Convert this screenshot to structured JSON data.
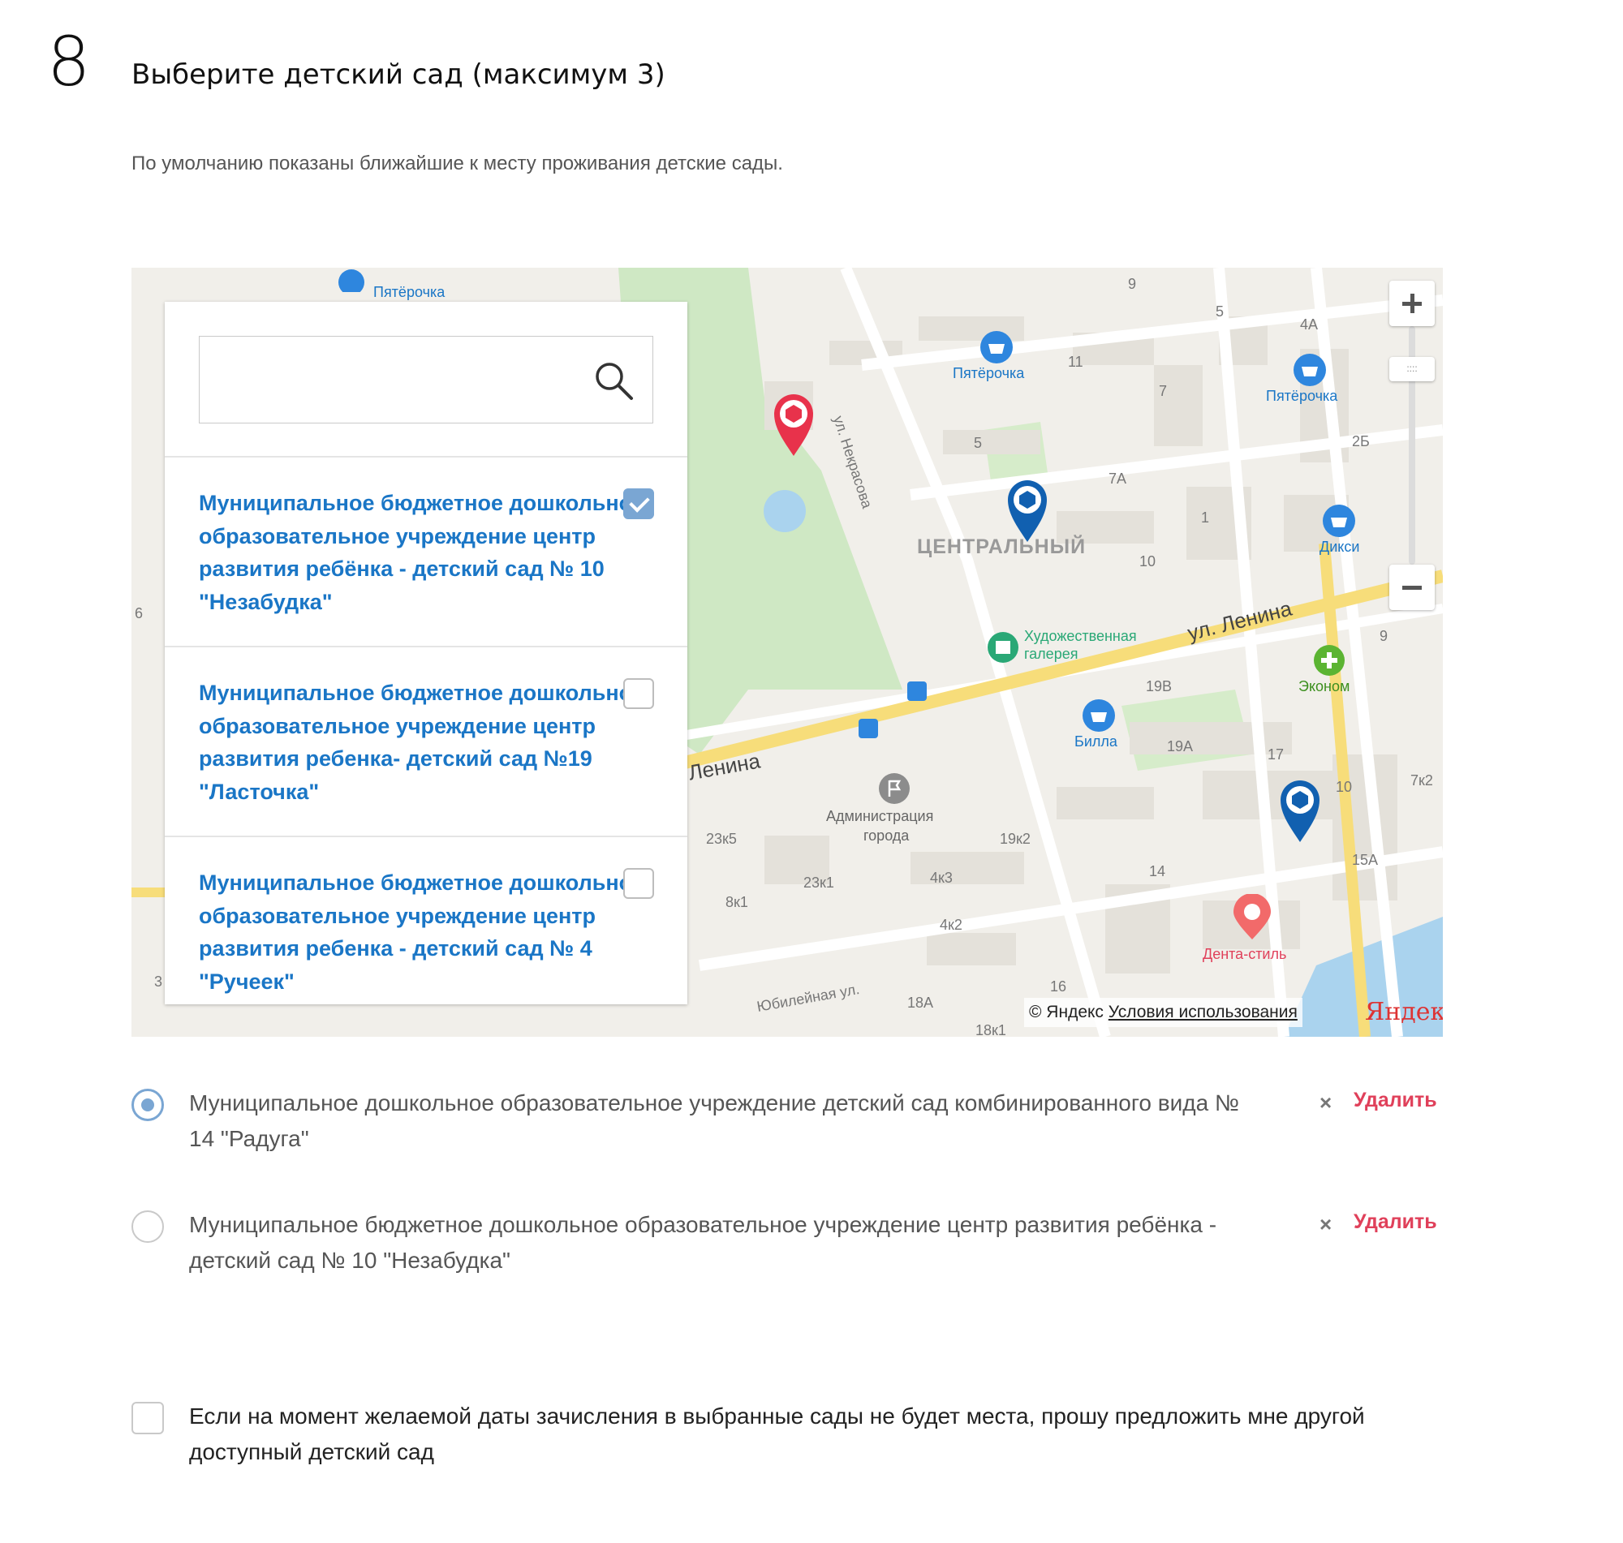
{
  "step": {
    "number": "8",
    "title": "Выберите детский сад (максимум 3)",
    "hint": "По умолчанию показаны ближайшие к месту проживания детские сады."
  },
  "search": {
    "placeholder": "",
    "icon": "search-icon"
  },
  "list": [
    {
      "name": "Муниципальное бюджетное дошкольное образовательное учреждение центр развития ребёнка - детский сад № 10 \"Незабудка\"",
      "checked": true
    },
    {
      "name": "Муниципальное бюджетное дошкольное образовательное учреждение центр развития ребенка- детский сад №19 \"Ласточка\"",
      "checked": false
    },
    {
      "name": "Муниципальное бюджетное дошкольное образовательное учреждение центр развития ребенка - детский сад № 4 \"Ручеек\"",
      "checked": false
    }
  ],
  "map": {
    "streets": {
      "nekrasova": "ул. Некрасова",
      "lenina": "ул. Ленина",
      "lenina_left": "Ленина",
      "yubileynaya": "Юбилейная ул."
    },
    "district": "ЦЕНТРАЛЬНЫЙ",
    "poi": {
      "pyaterochka_top": "Пятёрочка",
      "pyaterochka_1": "Пятёрочка",
      "pyaterochka_2": "Пятёрочка",
      "diksi": "Дикси",
      "gallery_1": "Художественная",
      "gallery_2": "галерея",
      "ekonom": "Эконом",
      "billa": "Билла",
      "admin_1": "Администрация",
      "admin_2": "города",
      "denta": "Дента-стиль"
    },
    "house_numbers": [
      "9",
      "5",
      "4А",
      "11",
      "7",
      "2Б",
      "5",
      "7А",
      "1",
      "10",
      "9",
      "19В",
      "19А",
      "17",
      "10",
      "7к2",
      "15А",
      "14",
      "19к2",
      "23к5",
      "23к1",
      "8к1",
      "4к3",
      "4к2",
      "16",
      "18А",
      "18к1",
      "6",
      "3"
    ],
    "copyright": "© Яндекс",
    "terms": "Условия использования",
    "logo": "Яндекс",
    "colors": {
      "selected_pin": "#e8324b",
      "pin": "#1160b0",
      "park": "#cfe8c4",
      "road": "#f7dd7a",
      "poi": "#1a76c6"
    }
  },
  "choices": [
    {
      "text": "Муниципальное дошкольное образовательное учреждение детский сад комбинированного вида № 14 \"Радуга\"",
      "selected": true,
      "remove_label": "Удалить"
    },
    {
      "text": "Муниципальное бюджетное дошкольное образовательное учреждение центр развития ребёнка - детский сад № 10 \"Незабудка\"",
      "selected": false,
      "remove_label": "Удалить"
    }
  ],
  "remove_icon": "×",
  "agree": {
    "text": "Если на момент желаемой даты зачисления в выбранные сады не будет места, прошу предложить мне другой доступный детский сад",
    "checked": false
  }
}
